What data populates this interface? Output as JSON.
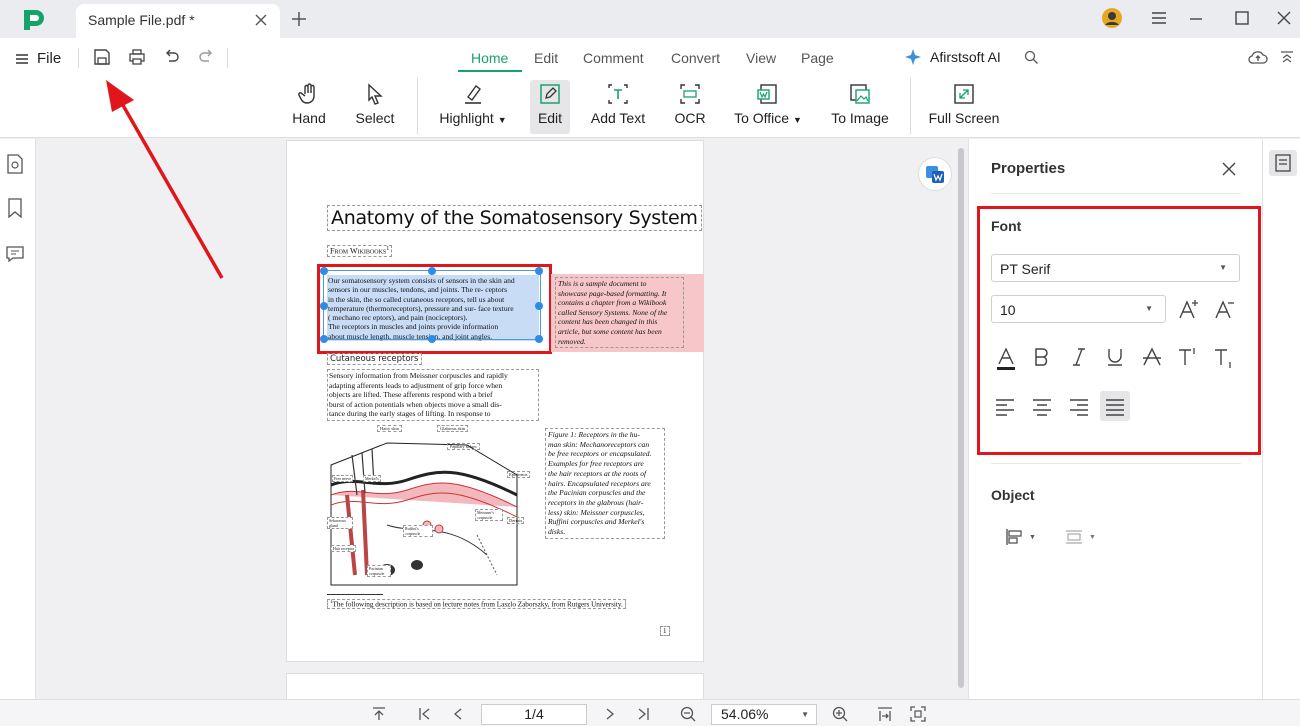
{
  "window": {
    "tab_title": "Sample File.pdf *"
  },
  "menu": {
    "file_label": "File",
    "tabs": [
      "Home",
      "Edit",
      "Comment",
      "Convert",
      "View",
      "Page"
    ],
    "ai_label": "Afirstsoft AI"
  },
  "toolbar": {
    "tools": [
      "Hand",
      "Select",
      "Highlight",
      "Edit",
      "Add Text",
      "OCR",
      "To Office",
      "To Image",
      "Full Screen"
    ]
  },
  "document": {
    "title": "Anatomy of the Somatosensory System",
    "from": "From Wikibooks",
    "from_sup": "1",
    "selected_lines": [
      "Our somatosensory system consists of  sensors in the skin  and",
      "sensors in our muscles, tendons, and joints. The re- ceptors",
      "in the skin, the so  called cutaneous receptors,  tell  us about",
      "temperature (thermoreceptors),  pressure and sur-  face  texture",
      "( mechano rec eptors),  and  pain (nociceptors).",
      "The receptors in muscles and joints provide information",
      "about muscle length, muscle  tension, and joint angles."
    ],
    "note_lines": [
      "This is a sample document to",
      "showcase page-based formatting. It",
      "contains a chapter from a Wikibook",
      "called Sensory Systems. None of the",
      "content has been changed in this",
      "article, but some content has been",
      "removed."
    ],
    "heading2": "Cutaneous receptors",
    "para_lines": [
      "Sensory information from Meissner corpuscles and rapidly",
      "adapting afferents leads to adjustment of grip force when",
      "objects are lifted. These afferents respond with a brief",
      "burst of action potentials when objects move a small dis-",
      "tance during the early stages of lifting. In response to"
    ],
    "figure_lines": [
      "Figure 1:  Receptors in the hu-",
      "man skin: Mechanoreceptors can",
      "be free receptors or encapsulated.",
      "Examples for free receptors are",
      "the hair receptors at the roots of",
      "hairs. Encapsulated receptors are",
      "the Pacinian corpuscles and the",
      "receptors in the glabrous (hair-",
      "less) skin: Meissner corpuscles,",
      "Ruffini corpuscles and Merkel's",
      "disks."
    ],
    "diagram_labels": {
      "hairy_skin": "Hairy skin",
      "glabrous_skin": "Glabrous skin",
      "papillary": "Papillary Ridges",
      "epidermis": "Epidermis",
      "dermis": "Dermis",
      "free_nerve": "Free nerve",
      "merkel": "Merkel's",
      "meissner": "Meissner's corpuscle",
      "sebaceous": "Sebaceous gland",
      "hair_receptor": "Hair receptor",
      "ruffini": "Ruffini's corpuscle",
      "pacinian": "Pacinian corpuscle"
    },
    "footnote": "The following description is based on lecture notes from Laszlo Zaborszky, from Rutgers University.",
    "footnote_mark": "1",
    "page_number": "1"
  },
  "properties": {
    "title": "Properties",
    "font_section": "Font",
    "font_family": "PT Serif",
    "font_size": "10",
    "object_section": "Object"
  },
  "bottom": {
    "page_indicator": "1/4",
    "zoom": "54.06%"
  },
  "colors": {
    "accent": "#16a36b",
    "annotation_red": "#e0161c",
    "selection_blue": "#c8dcf5",
    "note_pink": "#f6c6c8"
  }
}
